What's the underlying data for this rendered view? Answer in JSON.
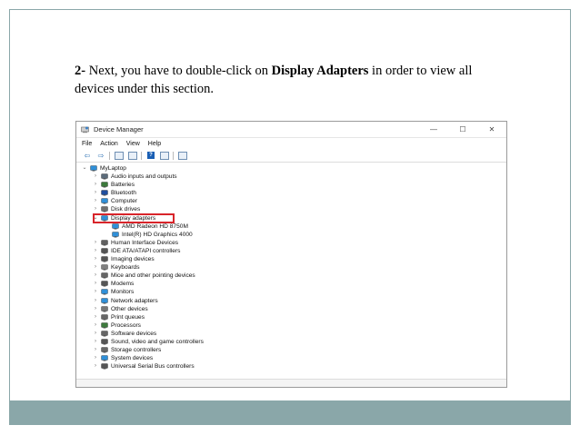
{
  "caption": {
    "step": "2-",
    "text_before": " Next, you have to double-click on ",
    "bold": "Display Adapters",
    "text_after": " in order to view all devices under this section."
  },
  "window": {
    "title": "Device Manager",
    "controls": {
      "minimize": "—",
      "maximize": "☐",
      "close": "✕"
    },
    "menu": [
      "File",
      "Action",
      "View",
      "Help"
    ]
  },
  "tree": {
    "root": "MyLaptop",
    "items": [
      {
        "label": "Audio inputs and outputs",
        "icon": "audio-icon",
        "color": "#5b6b7a"
      },
      {
        "label": "Batteries",
        "icon": "battery-icon",
        "color": "#3b7a3b"
      },
      {
        "label": "Bluetooth",
        "icon": "bluetooth-icon",
        "color": "#1f4e9e"
      },
      {
        "label": "Computer",
        "icon": "computer-icon",
        "color": "#2f8fd8"
      },
      {
        "label": "Disk drives",
        "icon": "disk-drive-icon",
        "color": "#707070"
      },
      {
        "label": "Display adapters",
        "icon": "display-adapter-icon",
        "color": "#2f8fd8",
        "expanded": true,
        "children": [
          {
            "label": "AMD Radeon HD 8750M",
            "icon": "display-adapter-icon",
            "color": "#2f8fd8"
          },
          {
            "label": "Intel(R) HD Graphics 4000",
            "icon": "display-adapter-icon",
            "color": "#2f8fd8"
          }
        ]
      },
      {
        "label": "Human Interface Devices",
        "icon": "hid-icon",
        "color": "#606060"
      },
      {
        "label": "IDE ATA/ATAPI controllers",
        "icon": "ide-controller-icon",
        "color": "#555555"
      },
      {
        "label": "Imaging devices",
        "icon": "camera-icon",
        "color": "#555555"
      },
      {
        "label": "Keyboards",
        "icon": "keyboard-icon",
        "color": "#808080"
      },
      {
        "label": "Mice and other pointing devices",
        "icon": "mouse-icon",
        "color": "#666666"
      },
      {
        "label": "Modems",
        "icon": "modem-icon",
        "color": "#555555"
      },
      {
        "label": "Monitors",
        "icon": "monitor-icon",
        "color": "#2f8fd8"
      },
      {
        "label": "Network adapters",
        "icon": "network-adapter-icon",
        "color": "#2f8fd8"
      },
      {
        "label": "Other devices",
        "icon": "other-devices-icon",
        "color": "#777777"
      },
      {
        "label": "Print queues",
        "icon": "printer-icon",
        "color": "#666666"
      },
      {
        "label": "Processors",
        "icon": "processor-icon",
        "color": "#3c7a3c"
      },
      {
        "label": "Software devices",
        "icon": "software-device-icon",
        "color": "#666666"
      },
      {
        "label": "Sound, video and game controllers",
        "icon": "speaker-icon",
        "color": "#555555"
      },
      {
        "label": "Storage controllers",
        "icon": "storage-controller-icon",
        "color": "#666666"
      },
      {
        "label": "System devices",
        "icon": "system-devices-icon",
        "color": "#2f8fd8"
      },
      {
        "label": "Universal Serial Bus controllers",
        "icon": "usb-icon",
        "color": "#555555"
      }
    ]
  },
  "colors": {
    "footer_bar": "#8aa7a9",
    "highlight_border": "#d8242a"
  }
}
